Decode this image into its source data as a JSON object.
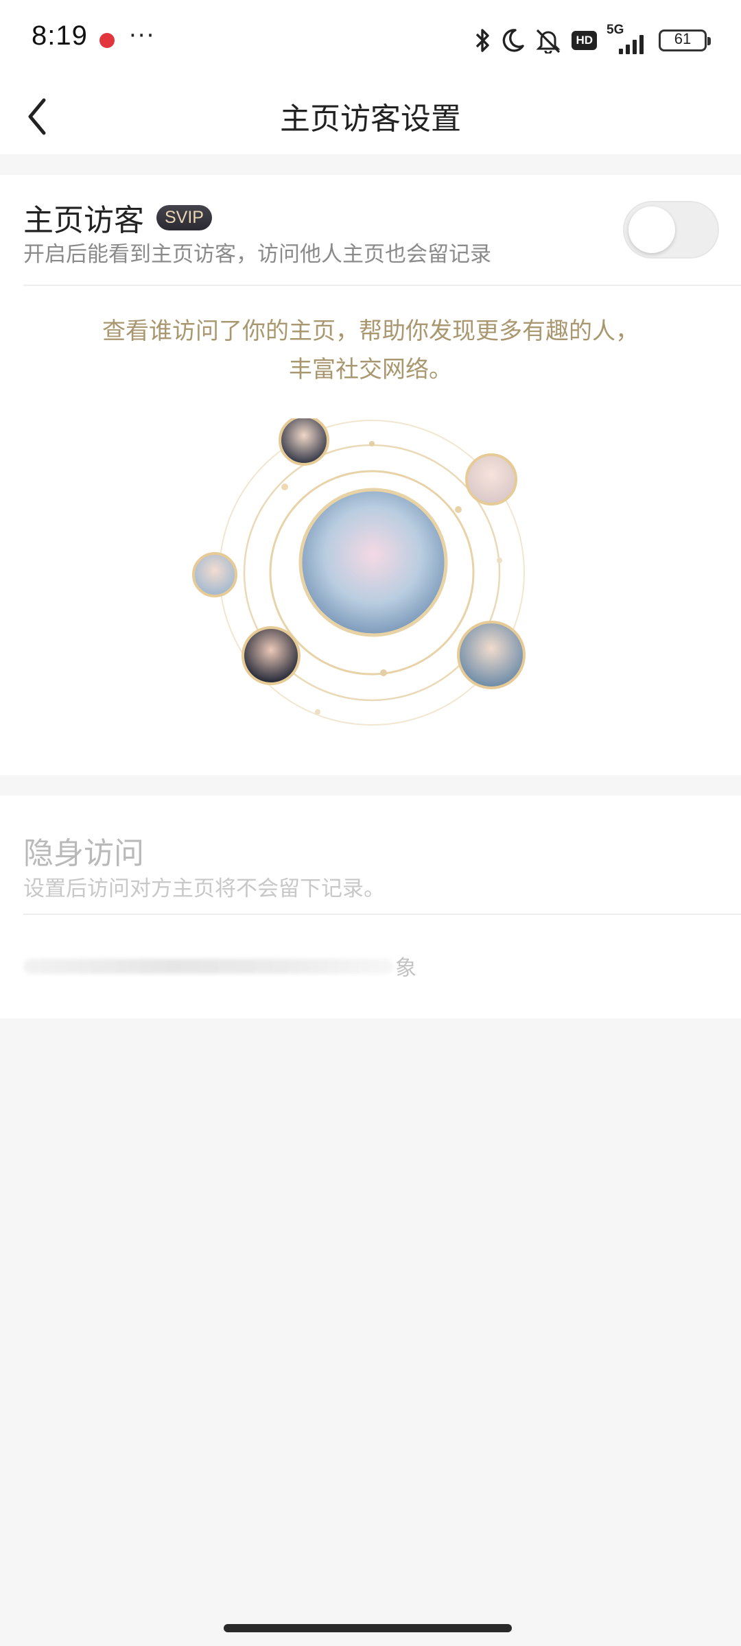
{
  "status_bar": {
    "time": "8:19",
    "more": "···",
    "hd": "HD",
    "network": "5G",
    "battery": "61",
    "icons": [
      "bluetooth-icon",
      "moon-icon",
      "mute-icon",
      "hd-icon",
      "signal-icon",
      "battery-icon"
    ]
  },
  "nav": {
    "title": "主页访客设置",
    "back_icon": "chevron-left-icon"
  },
  "visitor_setting": {
    "title": "主页访客",
    "badge": "SVIP",
    "description": "开启后能看到主页访客，访问他人主页也会留记录",
    "toggle_on": false,
    "promo_line1": "查看谁访问了你的主页，帮助你发现更多有趣的人，",
    "promo_line2": "丰富社交网络。"
  },
  "stealth_setting": {
    "title": "隐身访问",
    "description": "设置后访问对方主页将不会留下记录。",
    "blurred_row_end": "象"
  },
  "colors": {
    "accent_gold": "#a9976f",
    "orbit_gold": "#e8d6b0",
    "svip_bg": "#35333b"
  }
}
